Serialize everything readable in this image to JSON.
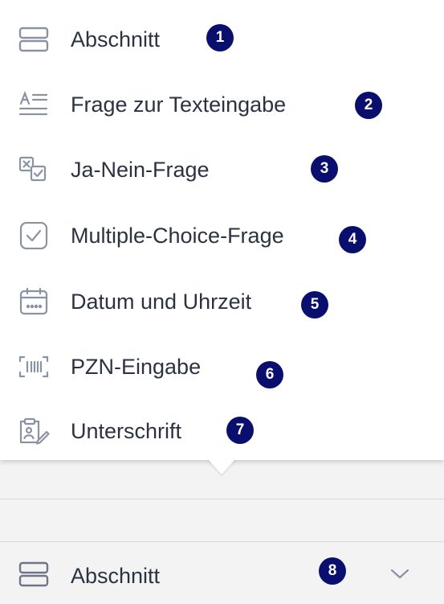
{
  "menu": {
    "items": [
      {
        "label": "Abschnitt",
        "icon": "section-icon",
        "badge": "1"
      },
      {
        "label": "Frage zur Texteingabe",
        "icon": "text-input-icon",
        "badge": "2"
      },
      {
        "label": "Ja-Nein-Frage",
        "icon": "yes-no-icon",
        "badge": "3"
      },
      {
        "label": "Multiple-Choice-Frage",
        "icon": "checkbox-icon",
        "badge": "4"
      },
      {
        "label": "Datum und Uhrzeit",
        "icon": "calendar-icon",
        "badge": "5"
      },
      {
        "label": "PZN-Eingabe",
        "icon": "barcode-scan-icon",
        "badge": "6"
      },
      {
        "label": "Unterschrift",
        "icon": "signature-icon",
        "badge": "7"
      }
    ]
  },
  "section_row": {
    "label": "Abschnitt",
    "icon": "section-icon",
    "badge": "8",
    "chevron": "chevron-down-icon"
  },
  "colors": {
    "badge_background": "#0a0f6e",
    "icon_stroke": "#8a93a3",
    "text": "#2b3342"
  }
}
